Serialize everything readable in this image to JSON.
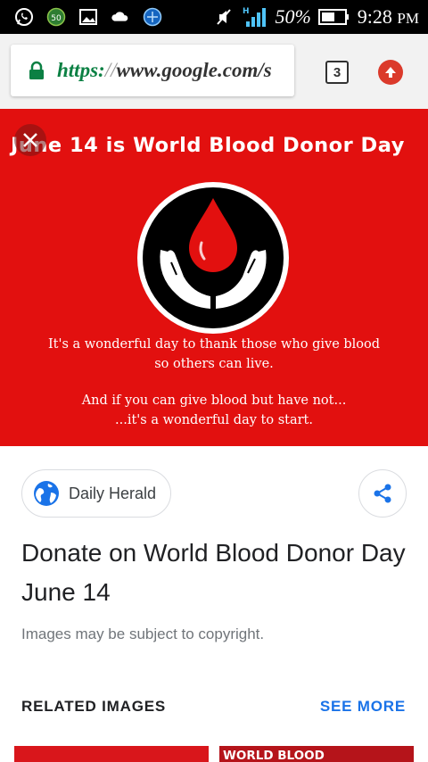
{
  "status_bar": {
    "battery_percent": "50%",
    "time": "9:28",
    "ampm": "PM",
    "network_type": "H",
    "notification_badge": "50",
    "icons": [
      "whatsapp-icon",
      "data-saver-icon",
      "gallery-icon",
      "cloud-icon",
      "browser-icon",
      "mute-icon",
      "signal-icon",
      "battery-icon"
    ]
  },
  "browser": {
    "url_scheme": "https:",
    "url_separator": "//",
    "url_rest": "www.google.com/s",
    "tab_count": "3",
    "colors": {
      "lock": "#0b8043",
      "update": "#db3a2b"
    }
  },
  "hero": {
    "title": "June 14 is World Blood Donor Day",
    "line1a": "It's a wonderful day to thank those who give blood",
    "line1b": "so others can live.",
    "line2a": "And if you can give blood but have not...",
    "line2b": "...it's a wonderful day to start.",
    "background": "#e2100f"
  },
  "result": {
    "source": "Daily Herald",
    "title": "Donate on World Blood Donor Day June 14",
    "copyright": "Images may be subject to copyright."
  },
  "related": {
    "header": "RELATED IMAGES",
    "see_more": "SEE MORE",
    "thumbnails": [
      {
        "caption": ""
      },
      {
        "caption": "WORLD BLOOD"
      }
    ]
  }
}
